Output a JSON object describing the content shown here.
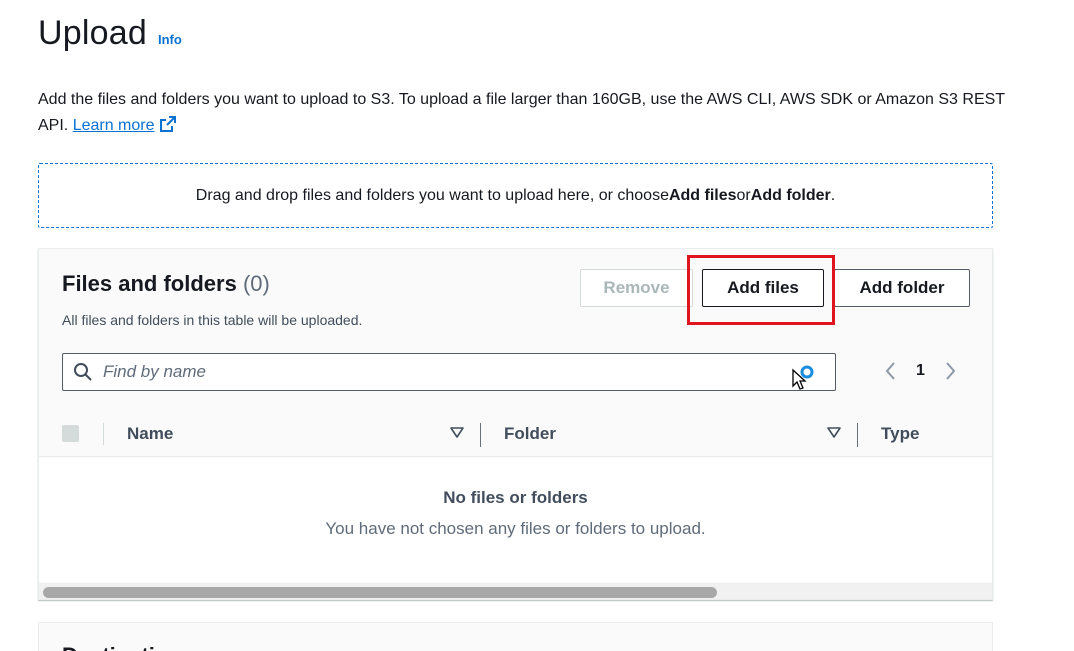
{
  "header": {
    "title": "Upload",
    "info_link": "Info"
  },
  "description": {
    "text": "Add the files and folders you want to upload to S3. To upload a file larger than 160GB, use the AWS CLI, AWS SDK or Amazon S3 REST API.",
    "learn_more": "Learn more"
  },
  "dropzone": {
    "prefix": "Drag and drop files and folders you want to upload here, or choose ",
    "add_files": "Add files",
    "middle": " or ",
    "add_folder": "Add folder",
    "suffix": "."
  },
  "files_panel": {
    "title": "Files and folders",
    "count": "(0)",
    "subtitle": "All files and folders in this table will be uploaded.",
    "buttons": {
      "remove": "Remove",
      "add_files": "Add files",
      "add_folder": "Add folder"
    },
    "search": {
      "placeholder": "Find by name"
    },
    "pagination": {
      "current_page": "1"
    },
    "columns": [
      "Name",
      "Folder",
      "Type"
    ],
    "empty": {
      "title": "No files or folders",
      "message": "You have not chosen any files or folders to upload."
    }
  },
  "destination_panel": {
    "title": "Destination"
  },
  "colors": {
    "link": "#0972d3",
    "highlight": "#e0141e"
  }
}
